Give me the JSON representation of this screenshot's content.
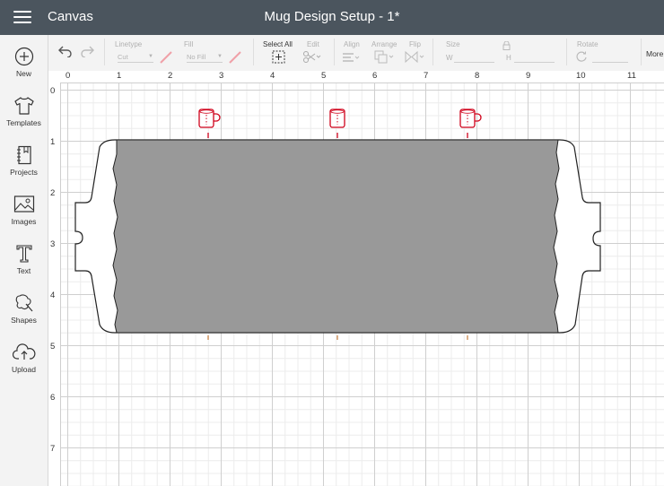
{
  "topbar": {
    "menu_icon": "hamburger-icon",
    "app_title": "Canvas",
    "doc_title": "Mug Design Setup - 1*",
    "background": "#4b555e"
  },
  "toolbar": {
    "linetype_label": "Linetype",
    "linetype_value": "Cut",
    "fill_label": "Fill",
    "fill_value": "No Fill",
    "select_all_label": "Select All",
    "edit_label": "Edit",
    "align_label": "Align",
    "arrange_label": "Arrange",
    "flip_label": "Flip",
    "size_label": "Size",
    "width_label": "W",
    "height_label": "H",
    "rotate_label": "Rotate",
    "more_label": "More"
  },
  "sidebar": {
    "items": [
      {
        "label": "New",
        "icon": "plus-circle-icon"
      },
      {
        "label": "Templates",
        "icon": "tshirt-icon"
      },
      {
        "label": "Projects",
        "icon": "notebook-icon"
      },
      {
        "label": "Images",
        "icon": "image-icon"
      },
      {
        "label": "Text",
        "icon": "text-t-icon"
      },
      {
        "label": "Shapes",
        "icon": "shapes-icon"
      },
      {
        "label": "Upload",
        "icon": "upload-cloud-icon"
      }
    ]
  },
  "rulers": {
    "top": [
      "0",
      "1",
      "2",
      "3",
      "4",
      "5",
      "6",
      "7",
      "8",
      "9",
      "10",
      "11"
    ],
    "left": [
      "0",
      "1",
      "2",
      "3",
      "4",
      "5",
      "6",
      "7"
    ]
  },
  "canvas": {
    "mug_icon": "mug-icon",
    "mug_color": "#d0021b",
    "design_fill": "#999999"
  }
}
